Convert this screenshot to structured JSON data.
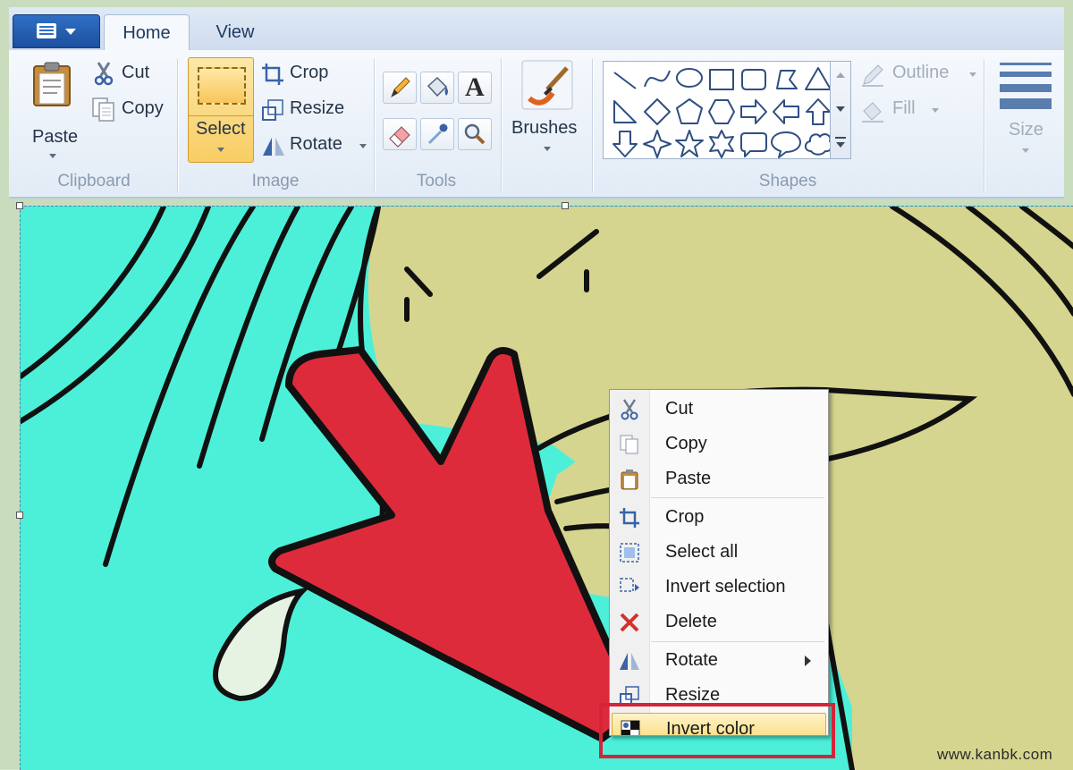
{
  "tabs": {
    "home": "Home",
    "view": "View"
  },
  "ribbon": {
    "clipboard": {
      "group_label": "Clipboard",
      "paste": "Paste",
      "cut": "Cut",
      "copy": "Copy"
    },
    "image": {
      "group_label": "Image",
      "select": "Select",
      "crop": "Crop",
      "resize": "Resize",
      "rotate": "Rotate"
    },
    "tools": {
      "group_label": "Tools",
      "text_tool_glyph": "A"
    },
    "brushes": {
      "label": "Brushes"
    },
    "shapes": {
      "group_label": "Shapes",
      "outline": "Outline",
      "fill": "Fill"
    },
    "size": {
      "label": "Size"
    }
  },
  "context_menu": {
    "items": [
      {
        "label": "Cut",
        "icon": "scissors-icon"
      },
      {
        "label": "Copy",
        "icon": "copy-icon"
      },
      {
        "label": "Paste",
        "icon": "paste-icon"
      },
      {
        "label": "Crop",
        "icon": "crop-icon"
      },
      {
        "label": "Select all",
        "icon": "select-all-icon"
      },
      {
        "label": "Invert selection",
        "icon": "invert-selection-icon"
      },
      {
        "label": "Delete",
        "icon": "delete-icon"
      },
      {
        "label": "Rotate",
        "icon": "rotate-icon"
      },
      {
        "label": "Resize",
        "icon": "resize-icon"
      },
      {
        "label": "Invert color",
        "icon": "invert-color-icon"
      }
    ],
    "highlighted_item": "Invert color"
  },
  "colors": {
    "canvas_cyan": "#4cf0d8",
    "canvas_khaki": "#d6d58f",
    "arrow_red": "#de2b3b",
    "highlight_box": "#d4243a"
  },
  "watermark": "www.kanbk.com"
}
